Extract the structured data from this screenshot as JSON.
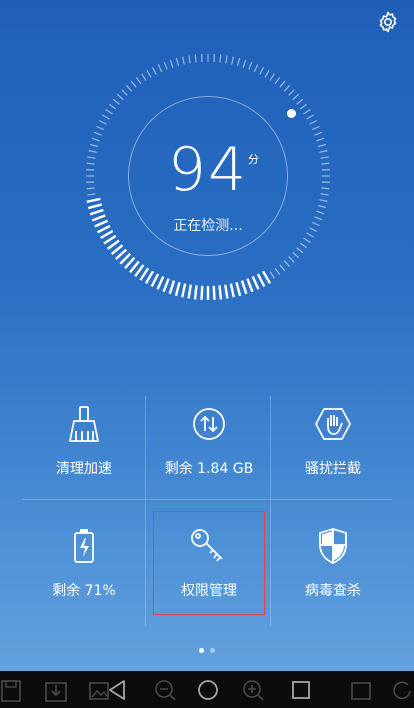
{
  "header": {
    "settings_icon": "gear-icon"
  },
  "score": {
    "value": "94",
    "unit": "分",
    "status": "正在检测..."
  },
  "tiles": [
    {
      "label": "清理加速",
      "icon": "broom-icon"
    },
    {
      "label": "剩余 1.84 GB",
      "icon": "storage-arrows-icon"
    },
    {
      "label": "骚扰拦截",
      "icon": "hand-block-icon"
    },
    {
      "label": "剩余 71%",
      "icon": "battery-icon"
    },
    {
      "label": "权限管理",
      "icon": "key-icon"
    },
    {
      "label": "病毒查杀",
      "icon": "shield-icon"
    }
  ],
  "pager": {
    "pages": 2,
    "current": 1
  },
  "colors": {
    "accent_border": "#e0454d",
    "bg_top": "#1f5fb8",
    "bg_bottom": "#6aa6e0"
  }
}
